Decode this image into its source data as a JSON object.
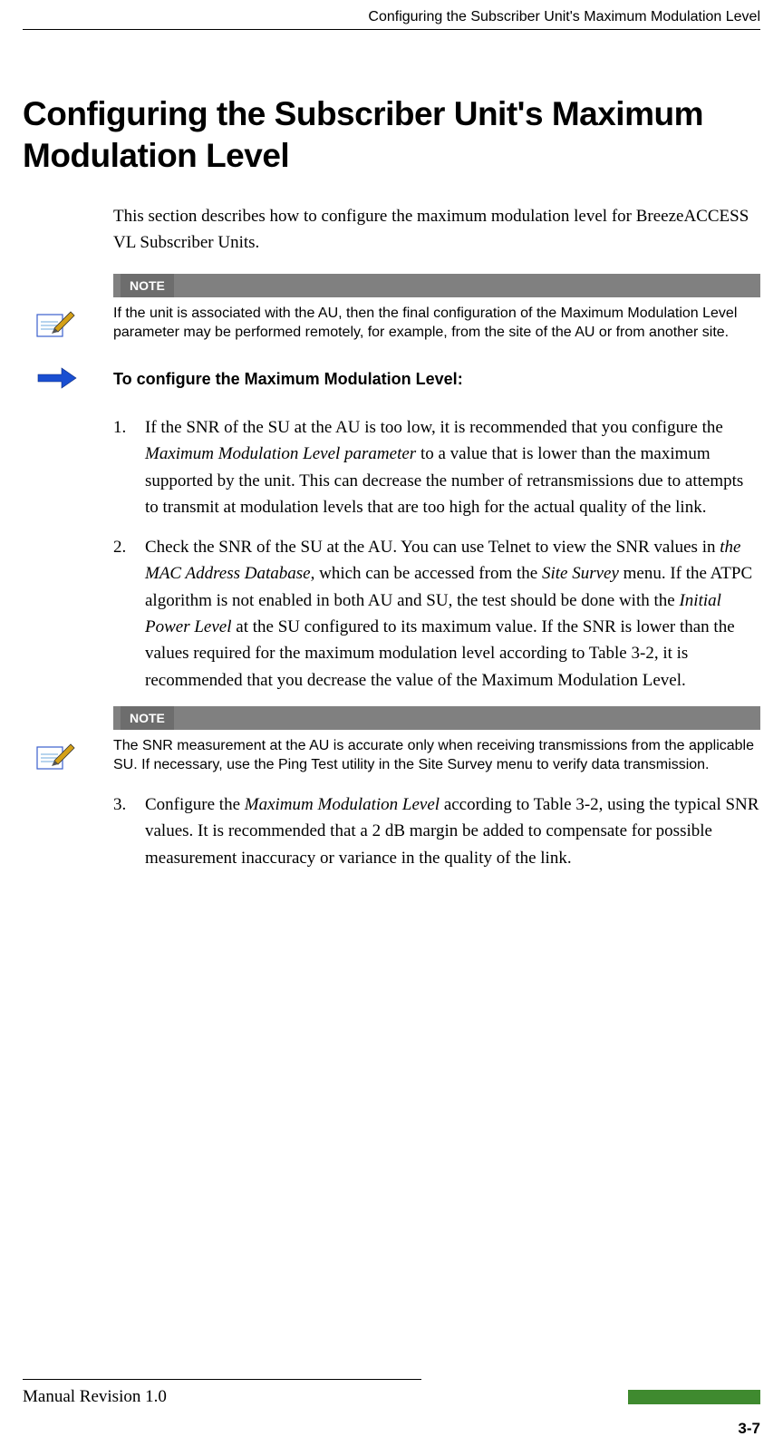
{
  "running_head": "Configuring the Subscriber Unit's Maximum Modulation Level",
  "title": "Configuring the Subscriber Unit's Maximum Modulation Level",
  "intro": "This section describes how to configure the maximum modulation level for BreezeACCESS VL Subscriber Units.",
  "note1": {
    "label": "NOTE",
    "text": "If the unit is associated with the AU, then the final configuration of the Maximum Modulation Level parameter may be performed remotely, for example, from the site of the AU or from another site."
  },
  "task_heading": "To configure the Maximum Modulation Level:",
  "steps": {
    "s1_a": "If the SNR of the SU at the AU is too low, it is recommended that you configure the ",
    "s1_i": "Maximum Modulation Level parameter",
    "s1_b": " to a value that is lower than the maximum supported by the unit. This can decrease the number of retransmissions due to attempts to transmit at modulation levels that are too high for the actual quality of the link.",
    "s2_a": "Check the SNR of the SU at the AU. You can use Telnet to view the SNR values in ",
    "s2_i1": "the MAC Address Database",
    "s2_b": ", which can be accessed from the ",
    "s2_i2": "Site Survey",
    "s2_c": " menu. If the ATPC algorithm is not enabled in both AU and SU, the test should be done with the ",
    "s2_i3": "Initial Power Level",
    "s2_d": " at the SU configured to its maximum value. If the SNR is lower than the values required for the maximum modulation level according to Table 3-2, it is recommended that you decrease the value of the Maximum Modulation Level.",
    "s3_a": "Configure the ",
    "s3_i": "Maximum Modulation Level",
    "s3_b": " according to Table 3-2, using the typical SNR values. It is recommended that a 2 dB margin be added to compensate for possible measurement inaccuracy or variance in the quality of the link."
  },
  "note2": {
    "label": "NOTE",
    "text": "The SNR measurement at the AU is accurate only when receiving transmissions from the applicable SU. If necessary, use the Ping Test utility in the Site Survey menu to verify data transmission."
  },
  "footer_text": "Manual Revision 1.0",
  "page_number": "3-7"
}
